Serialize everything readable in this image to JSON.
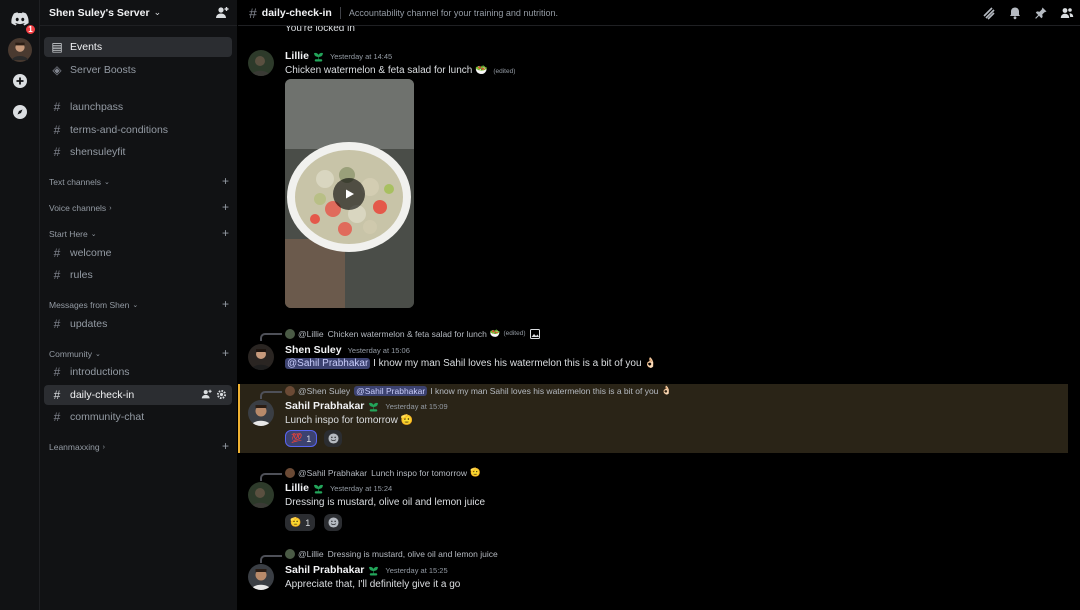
{
  "server": {
    "name": "Shen Suley's Server",
    "notification_badge": "1"
  },
  "sidebar": {
    "top_items": [
      {
        "label": "Events",
        "icon": "calendar-icon"
      },
      {
        "label": "Server Boosts",
        "icon": "boost-icon"
      }
    ],
    "channels_top": [
      "launchpass",
      "terms-and-conditions",
      "shensuleyfit"
    ],
    "categories": {
      "text": "Text channels",
      "voice": "Voice channels",
      "start": "Start Here",
      "messages": "Messages from Shen",
      "community": "Community",
      "leanmaxxing": "Leanmaxxing"
    },
    "start_channels": [
      "welcome",
      "rules"
    ],
    "messages_channels": [
      "updates"
    ],
    "community_channels": [
      "introductions",
      "daily-check-in",
      "community-chat"
    ]
  },
  "channel": {
    "name": "daily-check-in",
    "topic": "Accountability channel for your training and nutrition."
  },
  "messages": {
    "partial_top": "You're locked in",
    "m1": {
      "author": "Lillie",
      "time": "Yesterday at 14:45",
      "text": "Chicken watermelon & feta salad for lunch",
      "edited": "(edited)"
    },
    "m2": {
      "reply_author": "@Lillie",
      "reply_text": "Chicken watermelon & feta salad for lunch",
      "reply_edited": "(edited)",
      "author": "Shen Suley",
      "time": "Yesterday at 15:06",
      "mention": "@Sahil Prabhakar",
      "text": "I know my man Sahil loves his watermelon this is a bit of you"
    },
    "m3": {
      "reply_author": "@Shen Suley",
      "reply_mention": "@Sahil Prabhakar",
      "reply_text": "I know my man Sahil loves his watermelon this is a bit of you",
      "author": "Sahil Prabhakar",
      "time": "Yesterday at 15:09",
      "text": "Lunch inspo for tomorrow",
      "reaction_emoji": "💯",
      "reaction_count": "1"
    },
    "m4": {
      "reply_author": "@Sahil Prabhakar",
      "reply_text": "Lunch inspo for tomorrow",
      "author": "Lillie",
      "time": "Yesterday at 15:24",
      "text": "Dressing is mustard, olive oil and lemon juice",
      "reaction_emoji": "🫡",
      "reaction_count": "1"
    },
    "m5": {
      "reply_author": "@Lillie",
      "reply_text": "Dressing is mustard, olive oil and lemon juice",
      "author": "Sahil Prabhakar",
      "time": "Yesterday at 15:25",
      "text": "Appreciate that, I'll definitely give it a go"
    }
  },
  "colors": {
    "background": "#000000",
    "accent": "#5865f2",
    "highlight_border": "#f0b232",
    "role_green": "#23a55a"
  }
}
